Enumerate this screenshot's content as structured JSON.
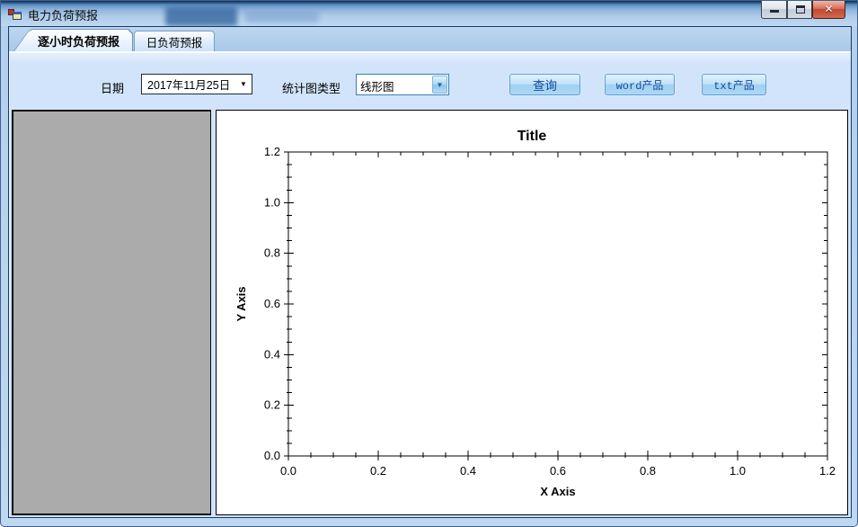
{
  "window": {
    "title": "电力负荷预报"
  },
  "icons": {
    "close": "✕",
    "dropdown_arrow": "▼",
    "combo_arrow": "▼"
  },
  "tabs": [
    {
      "label": "逐小时负荷预报",
      "selected": true
    },
    {
      "label": "日负荷预报",
      "selected": false
    }
  ],
  "toolbar": {
    "date_label": "日期",
    "date_value": "2017年11月25日",
    "chart_type_label": "统计图类型",
    "chart_type_value": "线形图",
    "query_button": "查询",
    "word_button": "word产品",
    "txt_button": "txt产品"
  },
  "chart_data": {
    "type": "line",
    "title": "Title",
    "xlabel": "X Axis",
    "ylabel": "Y Axis",
    "xlim": [
      0,
      1.2
    ],
    "ylim": [
      0,
      1.2
    ],
    "x_major_step": 0.2,
    "x_minor_step": 0.05,
    "y_major_step": 0.2,
    "y_minor_step": 0.05,
    "x_ticks": [
      "0.0",
      "0.2",
      "0.4",
      "0.6",
      "0.8",
      "1.0",
      "1.2"
    ],
    "y_ticks": [
      "0.0",
      "0.2",
      "0.4",
      "0.6",
      "0.8",
      "1.0",
      "1.2"
    ],
    "series": [],
    "grid": false,
    "legend": false
  },
  "colors": {
    "frame_blue": "#b3cfec",
    "toolbar_bg": "#cfe3fb",
    "button_text": "#134a9e",
    "panel_gray": "#ababab",
    "chart_axis": "#000000"
  }
}
